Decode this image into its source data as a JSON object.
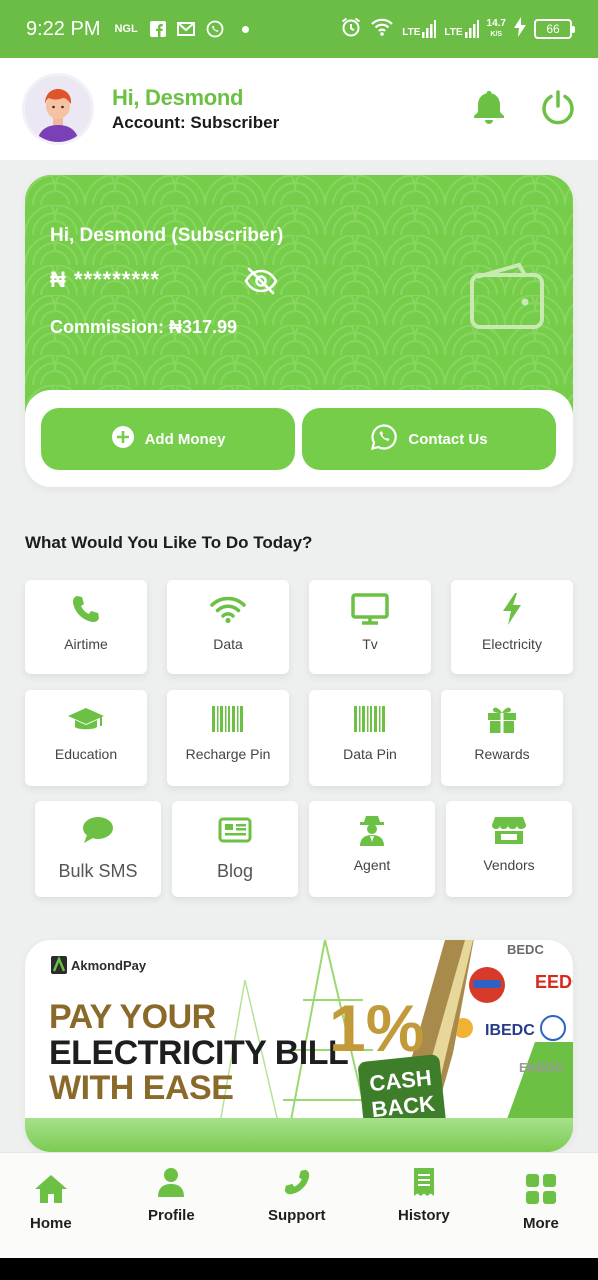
{
  "status_bar": {
    "time": "9:22 PM",
    "ngl": "NGL",
    "lte1": "LTE",
    "lte2": "LTE",
    "speed_value": "14.7",
    "speed_unit": "K/S",
    "battery": "66"
  },
  "header": {
    "greeting": "Hi, Desmond",
    "account": "Account: Subscriber"
  },
  "wallet": {
    "greeting": "Hi, Desmond (Subscriber)",
    "balance_masked": "₦ *********",
    "commission": "Commission: ₦317.99",
    "add_money_label": "Add Money",
    "contact_us_label": "Contact Us"
  },
  "services": {
    "title": "What Would You Like To Do Today?",
    "items": [
      {
        "label": "Airtime",
        "icon": "phone-icon"
      },
      {
        "label": "Data",
        "icon": "wifi-icon"
      },
      {
        "label": "Tv",
        "icon": "tv-icon"
      },
      {
        "label": "Electricity",
        "icon": "bolt-icon"
      },
      {
        "label": "Education",
        "icon": "graduation-cap-icon"
      },
      {
        "label": "Recharge Pin",
        "icon": "barcode-icon"
      },
      {
        "label": "Data Pin",
        "icon": "barcode-icon"
      },
      {
        "label": "Rewards",
        "icon": "gift-icon"
      },
      {
        "label": "Bulk SMS",
        "icon": "chat-bubble-icon"
      },
      {
        "label": "Blog",
        "icon": "newspaper-icon"
      },
      {
        "label": "Agent",
        "icon": "agent-icon"
      },
      {
        "label": "Vendors",
        "icon": "store-icon"
      }
    ]
  },
  "banner": {
    "brand": "AkmondPay",
    "line1": "PAY YOUR",
    "line2": "ELECTRICITY BILL",
    "line3": "WITH EASE",
    "percent": "1%",
    "cashback_1": "CASH",
    "cashback_2": "BACK",
    "disco_1": "EEDC",
    "disco_2": "IBEDC",
    "disco_3": "BEDC",
    "disco_4": "EKEDC"
  },
  "bottom_nav": [
    {
      "label": "Home",
      "icon": "home-icon"
    },
    {
      "label": "Profile",
      "icon": "user-icon"
    },
    {
      "label": "Support",
      "icon": "phone-icon"
    },
    {
      "label": "History",
      "icon": "receipt-icon"
    },
    {
      "label": "More",
      "icon": "grid-icon"
    }
  ],
  "colors": {
    "brand_green": "#6cbd45",
    "card_green": "#76cd4a",
    "accent_green": "#6cc145"
  }
}
